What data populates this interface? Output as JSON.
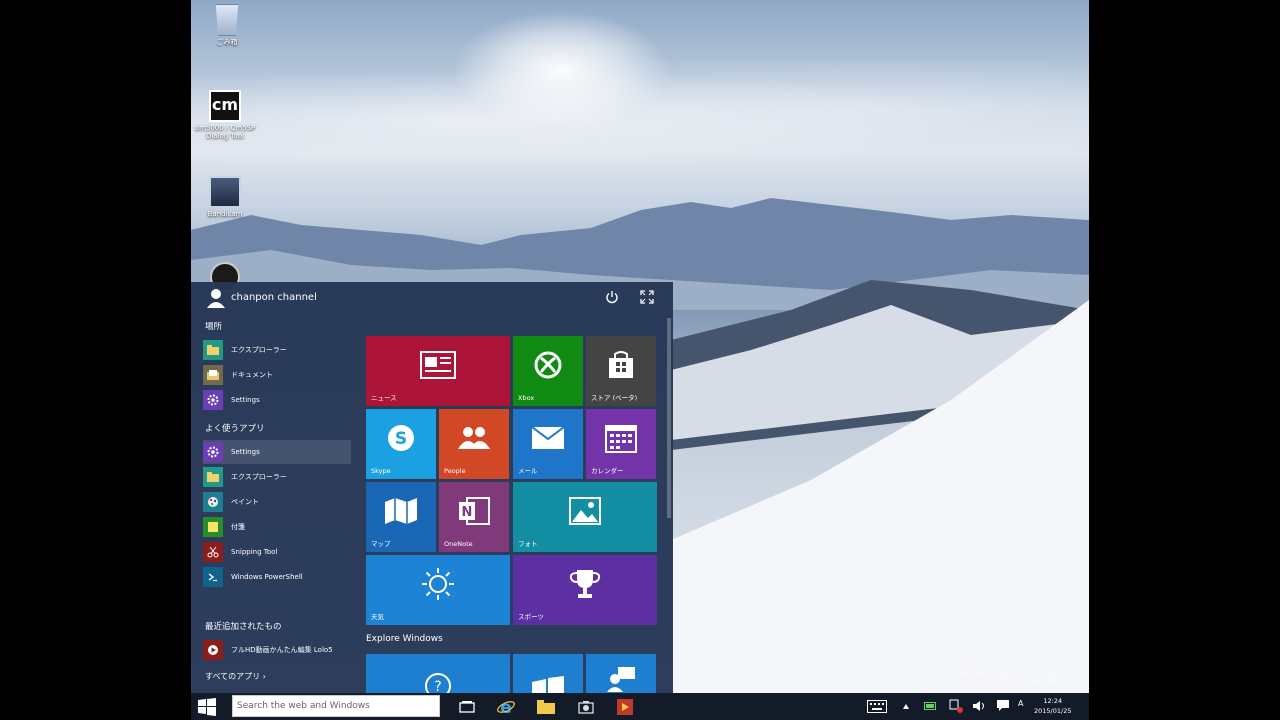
{
  "desktop": {
    "icons": [
      {
        "label": "ごみ箱",
        "icon": "recycle-bin-icon"
      },
      {
        "label": "dm5000 / Cm5SP Dialog Tool",
        "icon": "cm-app-icon"
      },
      {
        "label": "Bandicam",
        "icon": "camera-app-icon"
      },
      {
        "label": "",
        "icon": "disc-app-icon"
      }
    ]
  },
  "start_menu": {
    "user_name": "chanpon channel",
    "places_title": "場所",
    "places": [
      {
        "label": "エクスプローラー",
        "color": "#1e9a86"
      },
      {
        "label": "ドキュメント",
        "color": "#6f6a50"
      },
      {
        "label": "Settings",
        "color": "#6b3fb3"
      }
    ],
    "frequent_title": "よく使うアプリ",
    "frequent": [
      {
        "label": "Settings",
        "color": "#6b3fb3"
      },
      {
        "label": "エクスプローラー",
        "color": "#1e9a86"
      },
      {
        "label": "ペイント",
        "color": "#1f7e92"
      },
      {
        "label": "付箋",
        "color": "#2a8c2a"
      },
      {
        "label": "Snipping Tool",
        "color": "#8b1d1d"
      },
      {
        "label": "Windows PowerShell",
        "color": "#12628a"
      }
    ],
    "recent_title": "最近追加されたもの",
    "recent": [
      {
        "label": "フルHD動画かんたん編集 Lolo5",
        "color": "#8b1d1d"
      }
    ],
    "all_apps": "すべてのアプリ ›",
    "explore_title": "Explore Windows",
    "tiles": [
      {
        "label": "ニュース",
        "color": "#ad1538",
        "icon": "news-icon"
      },
      {
        "label": "Xbox",
        "color": "#118a14",
        "icon": "xbox-icon"
      },
      {
        "label": "ストア (ベータ)",
        "color": "#444444",
        "icon": "store-icon"
      },
      {
        "label": "Skype",
        "color": "#1ba1e2",
        "icon": "skype-icon"
      },
      {
        "label": "People",
        "color": "#d24726",
        "icon": "people-icon"
      },
      {
        "label": "メール",
        "color": "#1f75c7",
        "icon": "mail-icon"
      },
      {
        "label": "カレンダー",
        "color": "#7234a8",
        "icon": "calendar-icon"
      },
      {
        "label": "マップ",
        "color": "#1a68b5",
        "icon": "maps-icon"
      },
      {
        "label": "OneNote",
        "color": "#80397b",
        "icon": "onenote-icon"
      },
      {
        "label": "フォト",
        "color": "#148ea3",
        "icon": "photos-icon"
      },
      {
        "label": "天気",
        "color": "#1d83d4",
        "icon": "weather-icon"
      },
      {
        "label": "スポーツ",
        "color": "#5c2fa3",
        "icon": "sports-icon"
      },
      {
        "label": "",
        "color": "#1e7fd1",
        "icon": "help-icon"
      },
      {
        "label": "",
        "color": "#1e7fd1",
        "icon": "windows-icon"
      },
      {
        "label": "",
        "color": "#1e7fd1",
        "icon": "feedback-icon"
      }
    ]
  },
  "taskbar": {
    "search_placeholder": "Search the web and Windows",
    "tray_ime": "A",
    "clock_time": "12:24",
    "clock_date": "2015/01/25"
  },
  "watermark": {
    "line1": "Windows 10 Pro Technical Preview",
    "line2": "評価コピー。Build 9926"
  }
}
